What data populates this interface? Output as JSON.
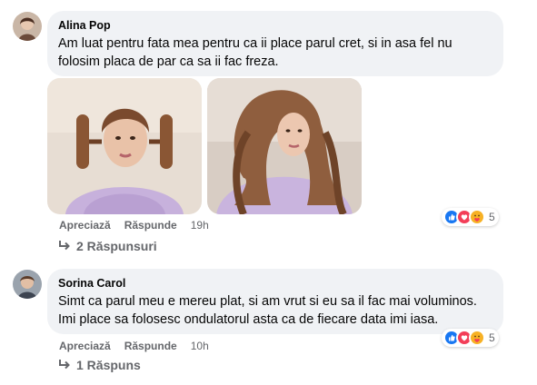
{
  "comments": [
    {
      "author": "Alina Pop",
      "text_lines": [
        "Am luat pentru fata mea pentru ca ii place parul cret, si in asa fel nu",
        "folosim placa de par ca sa ii fac freza."
      ],
      "actions": {
        "like": "Apreciază",
        "reply": "Răspunde",
        "time": "19h"
      },
      "reactions": {
        "icons": [
          "like-icon",
          "love-icon",
          "care-icon"
        ],
        "count": "5"
      },
      "replies_label": "2 Răspunsuri"
    },
    {
      "author": "Sorina Carol",
      "text_lines": [
        "Simt ca parul meu e mereu plat, si am vrut si eu sa il fac mai voluminos.",
        "Imi place sa folosesc ondulatorul asta ca de fiecare data imi iasa."
      ],
      "actions": {
        "like": "Apreciază",
        "reply": "Răspunde",
        "time": "10h"
      },
      "reactions": {
        "icons": [
          "like-icon",
          "love-icon",
          "care-icon"
        ],
        "count": "5"
      },
      "replies_label": "1 Răspuns"
    }
  ],
  "colors": {
    "bubble": "#f0f2f5",
    "secondary_text": "#65676b",
    "like_blue": "#1877f2",
    "love_red": "#f33e58",
    "care_yellow": "#f7b125"
  }
}
